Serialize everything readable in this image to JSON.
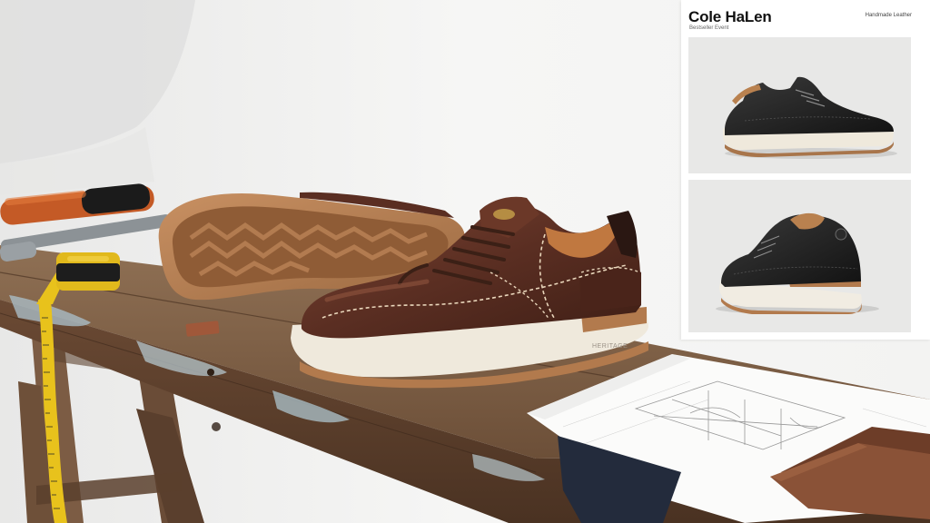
{
  "panel": {
    "brand": "Cole HaLen",
    "subtitle": "Bestseller Event",
    "tagline": "Handmade Leather"
  },
  "shoe": {
    "sole_stamp": "HERITAGE"
  },
  "colors": {
    "leather_brown": "#5a2e22",
    "leather_black": "#1b1b1b",
    "gum_sole": "#b27a4d",
    "cream_midsole": "#efe9dc",
    "tape_yellow": "#e8c21c"
  },
  "icons": [
    "tape-measure-icon",
    "screwdriver-icon",
    "wrench-icon"
  ]
}
